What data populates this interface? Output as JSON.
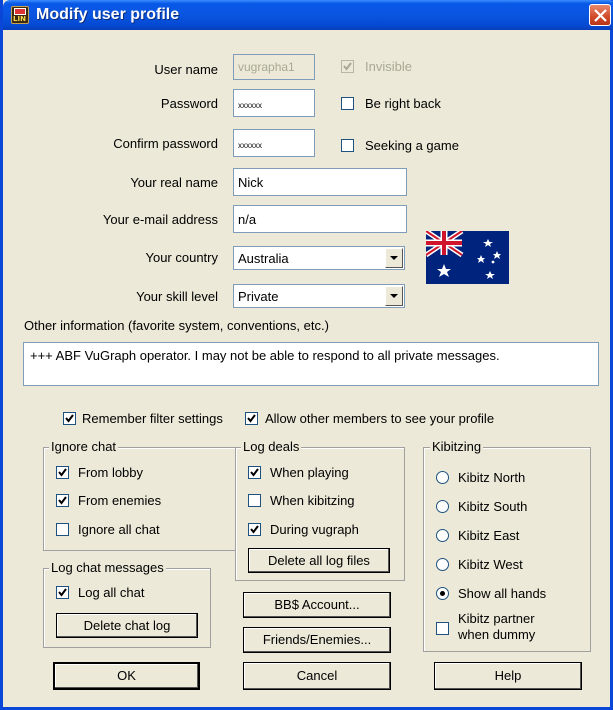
{
  "window": {
    "title": "Modify user profile"
  },
  "fields": {
    "username_label": "User name",
    "username_value": "vugrapha1",
    "password_label": "Password",
    "password_value": "xxxxxx",
    "confirm_label": "Confirm password",
    "confirm_value": "xxxxxx",
    "realname_label": "Your real name",
    "realname_value": "Nick",
    "email_label": "Your e-mail address",
    "email_value": "n/a",
    "country_label": "Your country",
    "country_value": "Australia",
    "skill_label": "Your skill level",
    "skill_value": "Private",
    "other_label": "Other information (favorite system, conventions, etc.)",
    "other_value": "+++ ABF VuGraph operator. I may not be able to respond to all private messages."
  },
  "status_options": {
    "invisible": {
      "label": "Invisible",
      "checked": true,
      "disabled": true
    },
    "be_right_back": {
      "label": "Be right back",
      "checked": false
    },
    "seeking_game": {
      "label": "Seeking a game",
      "checked": false
    }
  },
  "options": {
    "remember_filter": {
      "label": "Remember filter settings",
      "checked": true
    },
    "allow_profile": {
      "label": "Allow other members to see your profile",
      "checked": true
    }
  },
  "ignore_chat": {
    "title": "Ignore chat",
    "items": [
      {
        "label": "From lobby",
        "checked": true
      },
      {
        "label": "From enemies",
        "checked": true
      },
      {
        "label": "Ignore all chat",
        "checked": false
      }
    ]
  },
  "log_deals": {
    "title": "Log deals",
    "items": [
      {
        "label": "When playing",
        "checked": true
      },
      {
        "label": "When kibitzing",
        "checked": false
      },
      {
        "label": "During vugraph",
        "checked": true
      }
    ],
    "delete_button": "Delete all log files"
  },
  "log_chat": {
    "title": "Log chat messages",
    "log_all": {
      "label": "Log all chat",
      "checked": true
    },
    "delete_button": "Delete chat log"
  },
  "kibitzing": {
    "title": "Kibitzing",
    "items": [
      {
        "label": "Kibitz North",
        "selected": false
      },
      {
        "label": "Kibitz South",
        "selected": false
      },
      {
        "label": "Kibitz East",
        "selected": false
      },
      {
        "label": "Kibitz West",
        "selected": false
      },
      {
        "label": "Show all hands",
        "selected": true
      }
    ],
    "partner_line1": "Kibitz partner",
    "partner_line2": "when dummy",
    "partner_checked": false
  },
  "buttons": {
    "account": "BB$ Account...",
    "friends": "Friends/Enemies...",
    "ok": "OK",
    "cancel": "Cancel",
    "help": "Help"
  },
  "colors": {
    "titlebar": "#0a56e0",
    "face": "#ece9d8",
    "field_border": "#7f9db9"
  }
}
